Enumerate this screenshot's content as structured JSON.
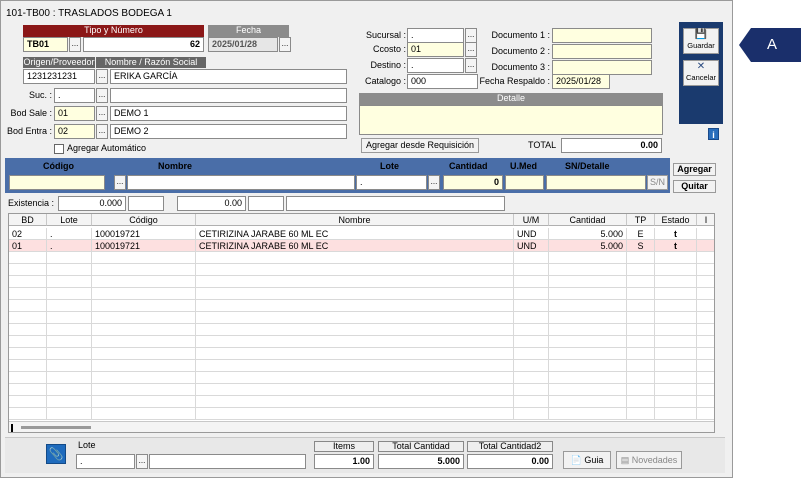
{
  "window": {
    "title": "101-TB00 : TRASLADOS BODEGA 1"
  },
  "header": {
    "tipo_numero_label": "Tipo y Número",
    "fecha_label": "Fecha",
    "tipo": "TB01",
    "numero": "62",
    "fecha": "2025/01/28",
    "origen_label": "Origen/Proveedor",
    "razon_label": "Nombre / Razón Social",
    "origen_code": "1231231231",
    "origen_name": "ERIKA GARCÍA",
    "suc_label": "Suc. :",
    "suc_value": ".",
    "bod_sale_label": "Bod Sale :",
    "bod_sale_code": "01",
    "bod_sale_name": "DEMO 1",
    "bod_entra_label": "Bod Entra :",
    "bod_entra_code": "02",
    "bod_entra_name": "DEMO 2",
    "agregar_auto_label": "Agregar Automático",
    "agregar_auto_checked": false
  },
  "right_fields": {
    "sucursal_label": "Sucursal :",
    "sucursal_value": ".",
    "ccosto_label": "Ccosto :",
    "ccosto_value": "01",
    "destino_label": "Destino :",
    "destino_value": ".",
    "catalogo_label": "Catalogo :",
    "catalogo_value": "000",
    "doc1_label": "Documento 1 :",
    "doc2_label": "Documento 2 :",
    "doc3_label": "Documento 3 :",
    "fecha_respaldo_label": "Fecha Respaldo :",
    "fecha_respaldo_value": "2025/01/28",
    "detalle_label": "Detalle",
    "agregar_requisicion": "Agregar desde Requisición",
    "total_label": "TOTAL",
    "total_value": "0.00"
  },
  "toolbar": {
    "guardar": "Guardar",
    "cancelar": "Cancelar",
    "info": "i"
  },
  "entry": {
    "codigo": "Código",
    "nombre": "Nombre",
    "lote": "Lote",
    "cantidad": "Cantidad",
    "umed": "U.Med",
    "sn_detalle": "SN/Detalle",
    "lote_value": ".",
    "cantidad_value": "0",
    "sn_button": "S/N",
    "agregar": "Agregar",
    "quitar": "Quitar",
    "existencia_label": "Existencia :",
    "existencia_value": "0.000",
    "existencia_value2": "0.00"
  },
  "grid": {
    "columns": [
      "BD",
      "Lote",
      "Código",
      "Nombre",
      "U/M",
      "Cantidad",
      "TP",
      "Estado",
      "I"
    ],
    "rows": [
      {
        "bd": "02",
        "lote": ".",
        "codigo": "100019721",
        "nombre": "CETIRIZINA JARABE 60 ML EC",
        "um": "UND",
        "cantidad": "5.000",
        "tp": "E",
        "estado": "t"
      },
      {
        "bd": "01",
        "lote": ".",
        "codigo": "100019721",
        "nombre": "CETIRIZINA JARABE 60 ML EC",
        "um": "UND",
        "cantidad": "5.000",
        "tp": "S",
        "estado": "t"
      }
    ]
  },
  "footer": {
    "lote_label": "Lote",
    "lote_value": ".",
    "items_label": "Items",
    "items_value": "1.00",
    "total_cantidad_label": "Total Cantidad",
    "total_cantidad_value": "5.000",
    "total_cantidad2_label": "Total Cantidad2",
    "total_cantidad2_value": "0.00",
    "guia": "Guia",
    "novedades": "Novedades"
  },
  "callout": {
    "label": "A"
  },
  "colors": {
    "accent_red": "#8b1717",
    "panel_blue": "#4a6ea8",
    "navy": "#1a3a6e",
    "field_yellow": "#ffffe0"
  }
}
